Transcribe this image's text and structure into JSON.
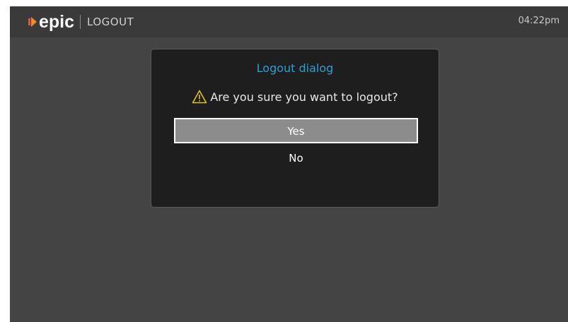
{
  "header": {
    "brand": "epic",
    "section_title": "LOGOUT",
    "time": "04:22pm"
  },
  "dialog": {
    "title": "Logout dialog",
    "message": "Are you sure you want to logout?",
    "warning_icon": "warning-icon",
    "buttons": {
      "yes": "Yes",
      "no": "No"
    },
    "selected": "Yes"
  },
  "colors": {
    "background": "#444444",
    "topbar": "#3a3a3a",
    "dialog_bg": "#1e1e1e",
    "title_accent": "#2a9fd6",
    "selected_button": "#8c8c8c",
    "warning": "#e0c21c"
  }
}
